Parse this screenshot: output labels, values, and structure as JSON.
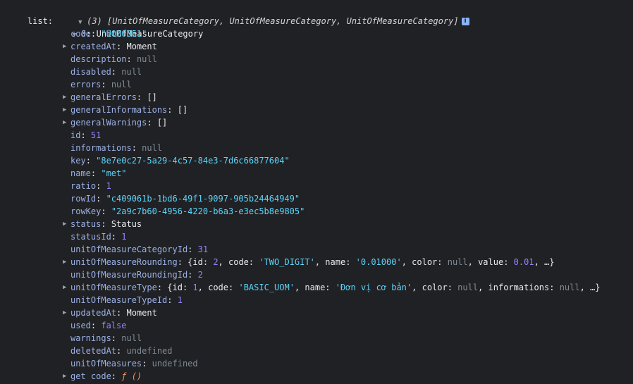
{
  "root": {
    "label": "list:",
    "summary": "(3) [UnitOfMeasureCategory, UnitOfMeasureCategory, UnitOfMeasureCategory]",
    "info_icon": "info-icon"
  },
  "item0": {
    "index": "0",
    "class_name": "UnitOfMeasureCategory"
  },
  "props": [
    {
      "key": "code",
      "value": "\"UOM0051\"",
      "type": "str",
      "expandable": false
    },
    {
      "key": "createdAt",
      "value": "Moment",
      "type": "obj",
      "expandable": true
    },
    {
      "key": "description",
      "value": "null",
      "type": "null",
      "expandable": false
    },
    {
      "key": "disabled",
      "value": "null",
      "type": "null",
      "expandable": false
    },
    {
      "key": "errors",
      "value": "null",
      "type": "null",
      "expandable": false
    },
    {
      "key": "generalErrors",
      "value": "[]",
      "type": "obj",
      "expandable": true
    },
    {
      "key": "generalInformations",
      "value": "[]",
      "type": "obj",
      "expandable": true
    },
    {
      "key": "generalWarnings",
      "value": "[]",
      "type": "obj",
      "expandable": true
    },
    {
      "key": "id",
      "value": "51",
      "type": "num",
      "expandable": false
    },
    {
      "key": "informations",
      "value": "null",
      "type": "null",
      "expandable": false
    },
    {
      "key": "key",
      "value": "\"8e7e0c27-5a29-4c57-84e3-7d6c66877604\"",
      "type": "str",
      "expandable": false
    },
    {
      "key": "name",
      "value": "\"met\"",
      "type": "str",
      "expandable": false
    },
    {
      "key": "ratio",
      "value": "1",
      "type": "num",
      "expandable": false
    },
    {
      "key": "rowId",
      "value": "\"c409061b-1bd6-49f1-9097-905b24464949\"",
      "type": "str",
      "expandable": false
    },
    {
      "key": "rowKey",
      "value": "\"2a9c7b60-4956-4220-b6a3-e3ec5b8e9805\"",
      "type": "str",
      "expandable": false
    },
    {
      "key": "status",
      "value": "Status",
      "type": "obj",
      "expandable": true
    },
    {
      "key": "statusId",
      "value": "1",
      "type": "num",
      "expandable": false
    },
    {
      "key": "unitOfMeasureCategoryId",
      "value": "31",
      "type": "num",
      "expandable": false
    },
    {
      "key": "unitOfMeasureRounding",
      "type": "preview",
      "expandable": true,
      "preview": [
        {
          "t": "punct",
          "v": "{"
        },
        {
          "t": "plain",
          "v": "id: "
        },
        {
          "t": "num",
          "v": "2"
        },
        {
          "t": "punct",
          "v": ", "
        },
        {
          "t": "plain",
          "v": "code: "
        },
        {
          "t": "str",
          "v": "'TWO_DIGIT'"
        },
        {
          "t": "punct",
          "v": ", "
        },
        {
          "t": "plain",
          "v": "name: "
        },
        {
          "t": "str",
          "v": "'0.01000'"
        },
        {
          "t": "punct",
          "v": ", "
        },
        {
          "t": "plain",
          "v": "color: "
        },
        {
          "t": "null",
          "v": "null"
        },
        {
          "t": "punct",
          "v": ", "
        },
        {
          "t": "plain",
          "v": "value: "
        },
        {
          "t": "num",
          "v": "0.01"
        },
        {
          "t": "punct",
          "v": ", …}"
        }
      ]
    },
    {
      "key": "unitOfMeasureRoundingId",
      "value": "2",
      "type": "num",
      "expandable": false
    },
    {
      "key": "unitOfMeasureType",
      "type": "preview",
      "expandable": true,
      "preview": [
        {
          "t": "punct",
          "v": "{"
        },
        {
          "t": "plain",
          "v": "id: "
        },
        {
          "t": "num",
          "v": "1"
        },
        {
          "t": "punct",
          "v": ", "
        },
        {
          "t": "plain",
          "v": "code: "
        },
        {
          "t": "str",
          "v": "'BASIC_UOM'"
        },
        {
          "t": "punct",
          "v": ", "
        },
        {
          "t": "plain",
          "v": "name: "
        },
        {
          "t": "str",
          "v": "'Đơn vị cơ bản'"
        },
        {
          "t": "punct",
          "v": ", "
        },
        {
          "t": "plain",
          "v": "color: "
        },
        {
          "t": "null",
          "v": "null"
        },
        {
          "t": "punct",
          "v": ", "
        },
        {
          "t": "plain",
          "v": "informations: "
        },
        {
          "t": "null",
          "v": "null"
        },
        {
          "t": "punct",
          "v": ", …}"
        }
      ]
    },
    {
      "key": "unitOfMeasureTypeId",
      "value": "1",
      "type": "num",
      "expandable": false
    },
    {
      "key": "updatedAt",
      "value": "Moment",
      "type": "obj",
      "expandable": true
    },
    {
      "key": "used",
      "value": "false",
      "type": "bool",
      "expandable": false
    },
    {
      "key": "warnings",
      "value": "null",
      "type": "null",
      "expandable": false
    },
    {
      "key": "deletedAt",
      "value": "undefined",
      "type": "null",
      "expandable": false
    },
    {
      "key": "unitOfMeasures",
      "value": "undefined",
      "type": "null",
      "expandable": false
    },
    {
      "key": "get code",
      "type": "getter",
      "expandable": true,
      "value": "ƒ ()"
    }
  ],
  "colors": {
    "background": "#202124",
    "key": "#9cb1e6",
    "string": "#5cd5fb",
    "number": "#9980ff",
    "null": "#7f8b95",
    "function": "#f28b54"
  }
}
